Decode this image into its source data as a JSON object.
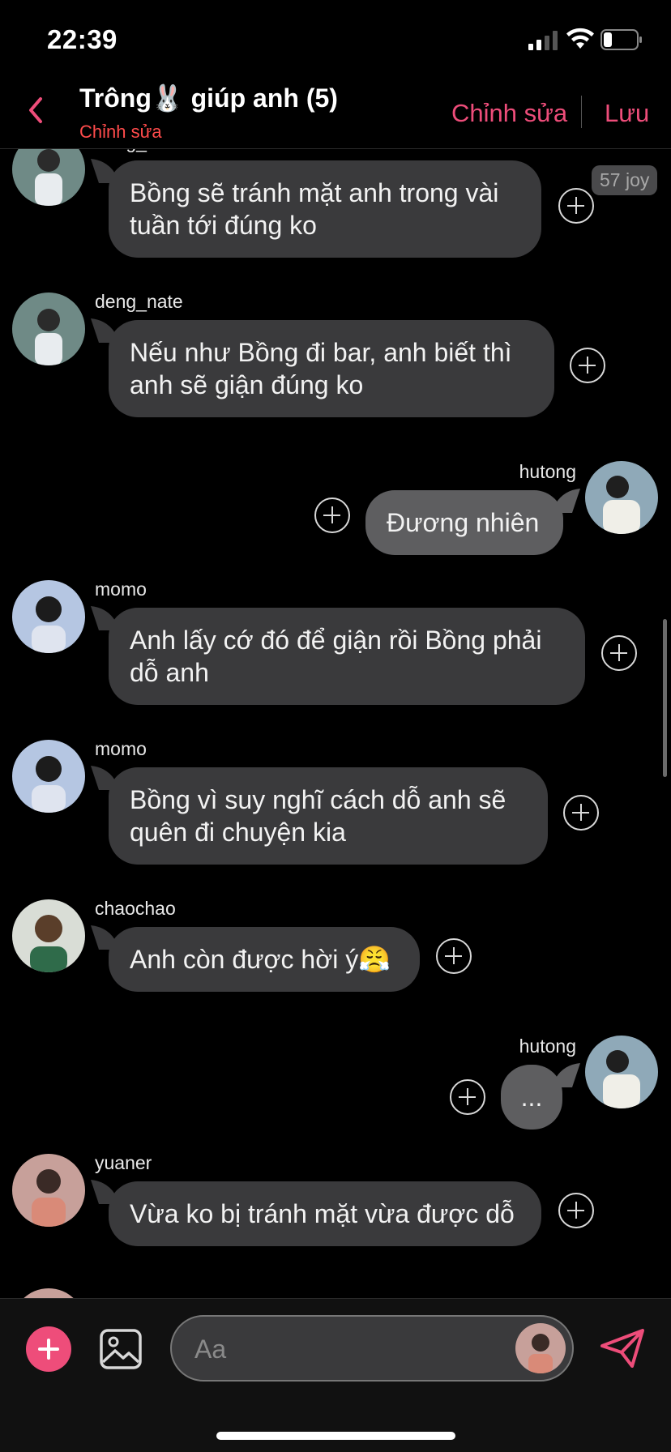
{
  "status_bar": {
    "time": "22:39"
  },
  "header": {
    "title_prefix": "Trông",
    "title_icon": "🐰",
    "title_suffix": "giúp anh (5)",
    "subtitle": "Chỉnh sửa",
    "edit_label": "Chỉnh sửa",
    "save_label": "Lưu"
  },
  "messages": [
    {
      "sender": "deng_nate",
      "side": "left",
      "text": "Bồng sẽ tránh mặt anh trong vài tuần tới đúng ko",
      "badge": "57 joy",
      "avatar": "man-white-shirt-avatar"
    },
    {
      "sender": "deng_nate",
      "side": "left",
      "text": "Nếu như Bồng đi bar, anh biết thì anh sẽ giận đúng ko",
      "avatar": "man-white-shirt-avatar"
    },
    {
      "sender": "hutong",
      "side": "right",
      "text": "Đương nhiên",
      "avatar": "man-knit-sweater-avatar"
    },
    {
      "sender": "momo",
      "side": "left",
      "text": "Anh lấy cớ đó để giận rồi Bồng phải dỗ anh",
      "avatar": "man-blue-background-avatar"
    },
    {
      "sender": "momo",
      "side": "left",
      "text": "Bồng vì suy nghĩ cách dỗ anh sẽ quên đi chuyện kia",
      "avatar": "man-blue-background-avatar"
    },
    {
      "sender": "chaochao",
      "side": "left",
      "text": "Anh còn được hời ý😤",
      "avatar": "man-green-shirt-avatar"
    },
    {
      "sender": "hutong",
      "side": "right",
      "text": "...",
      "avatar": "man-knit-sweater-avatar"
    },
    {
      "sender": "yuaner",
      "side": "left",
      "text": "Vừa ko bị tránh mặt vừa được dỗ",
      "avatar": "man-pink-flowers-avatar"
    }
  ],
  "composer": {
    "placeholder": "Aa"
  },
  "colors": {
    "accent": "#ee4d7a",
    "subtitle_red": "#ff4b4b",
    "bubble_left": "#3a3a3c",
    "bubble_right": "#5e5e60"
  }
}
